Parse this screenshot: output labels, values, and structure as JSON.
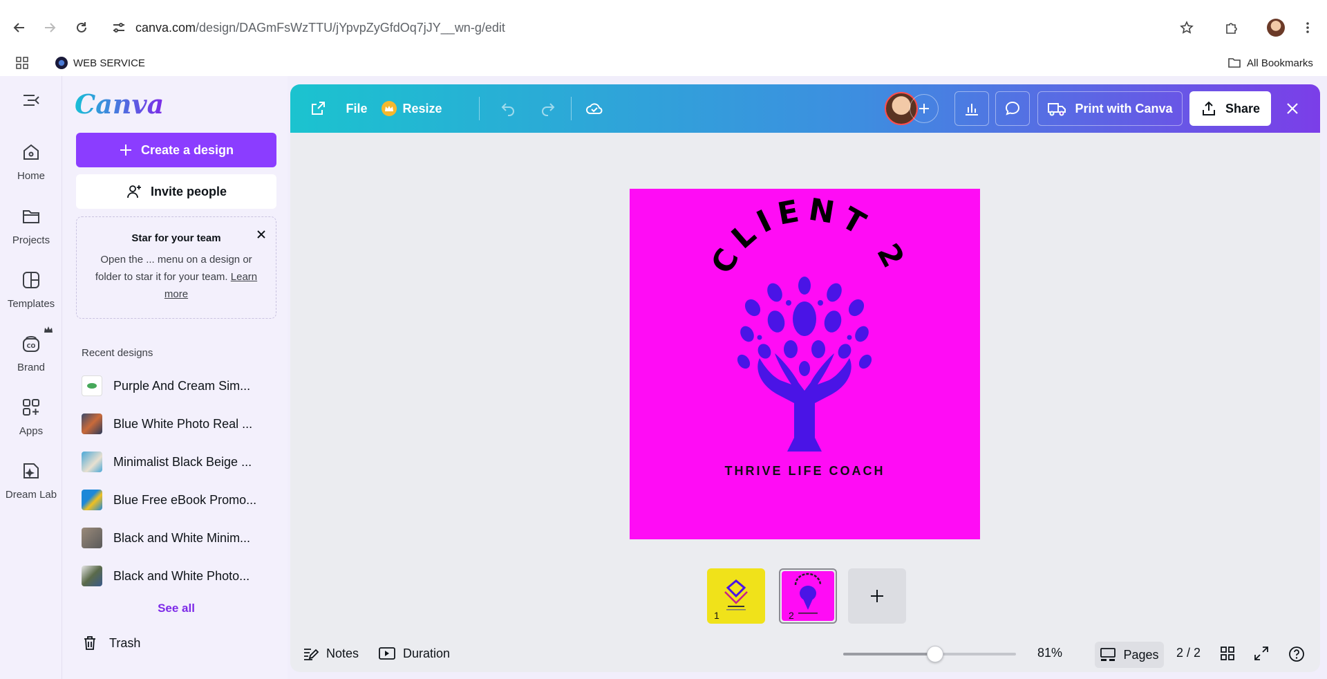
{
  "browser": {
    "url_host": "canva.com",
    "url_path": "/design/DAGmFsWzTTU/jYpvpZyGfdOq7jJY__wn-g/edit",
    "bookmark_label": "WEB SERVICE",
    "all_bookmarks_label": "All Bookmarks"
  },
  "rail": {
    "items": [
      {
        "label": "Home",
        "icon": "home-icon"
      },
      {
        "label": "Projects",
        "icon": "folder-icon"
      },
      {
        "label": "Templates",
        "icon": "templates-icon"
      },
      {
        "label": "Brand",
        "icon": "brand-icon"
      },
      {
        "label": "Apps",
        "icon": "apps-icon"
      },
      {
        "label": "Dream Lab",
        "icon": "dream-lab-icon"
      }
    ]
  },
  "panel": {
    "logo": "Canva",
    "create_label": "Create a design",
    "invite_label": "Invite people",
    "star_card": {
      "title": "Star for your team",
      "body": "Open the ... menu on a design or folder to star it for your team.",
      "link": "Learn more"
    },
    "recent_title": "Recent designs",
    "recent": [
      {
        "label": "Purple And Cream Sim...",
        "color": "#ffffff"
      },
      {
        "label": "Blue White Photo Real ...",
        "color": "#3a4a6b"
      },
      {
        "label": "Minimalist Black Beige ...",
        "color": "#4aa8d8"
      },
      {
        "label": "Blue Free eBook Promo...",
        "color": "#1e88d8"
      },
      {
        "label": "Black and White Minim...",
        "color": "#7a7a7a"
      },
      {
        "label": "Black and White Photo...",
        "color": "#5a6a4a"
      }
    ],
    "see_all": "See all",
    "trash": "Trash"
  },
  "topbar": {
    "file": "File",
    "resize": "Resize",
    "print": "Print with Canva",
    "share": "Share"
  },
  "design": {
    "title_text": "CLIENT 2",
    "tagline": "THRIVE LIFE COACH",
    "background": "#ff0cf5",
    "accent": "#4a14e6"
  },
  "pages": {
    "thumbs": [
      {
        "number": "1",
        "color": "#f0e21a"
      },
      {
        "number": "2",
        "color": "#ff0cf5"
      }
    ],
    "current": "2 / 2"
  },
  "bottombar": {
    "notes": "Notes",
    "duration": "Duration",
    "zoom": "81%",
    "zoom_level": 0.53,
    "pages": "Pages"
  }
}
